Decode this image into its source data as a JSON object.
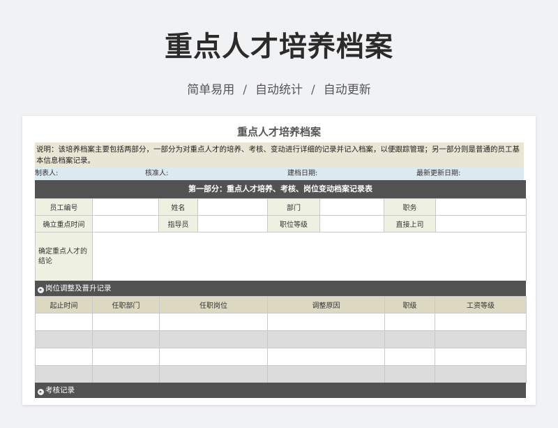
{
  "hero": {
    "title": "重点人才培养档案",
    "subtitle_items": [
      "简单易用",
      "自动统计",
      "自动更新"
    ],
    "separator": "/"
  },
  "document": {
    "title": "重点人才培养档案",
    "description": "说明：该培养档案主要包括两部分，一部分为对重点人才的培养、考核、变动进行详细的记录并记入档案，以便跟踪管理；另一部分则是普通的员工基本信息档案记录。",
    "meta": {
      "preparer": "制表人:",
      "approver": "核准人:",
      "created_date": "建档日期:",
      "updated_date": "最新更新日期:"
    },
    "part1_title": "第一部分：重点人才培养、考核、岗位变动档案记录表",
    "info_rows": [
      [
        "员工编号",
        "",
        "姓名",
        "",
        "部门",
        "",
        "职务",
        ""
      ],
      [
        "确立重点时间",
        "",
        "指导员",
        "",
        "职位等级",
        "",
        "直接上司",
        ""
      ]
    ],
    "conclusion_label": "确定重点人才的结论",
    "section_promotion": {
      "icon": "circle-arrow-icon",
      "label": "岗位调整及晋升记录",
      "headers": [
        "起止时间",
        "任职部门",
        "任职岗位",
        "调整原因",
        "职级",
        "工资等级"
      ],
      "row_count": 4
    },
    "section_assessment": {
      "icon": "circle-arrow-icon",
      "label": "考核记录"
    }
  },
  "colors": {
    "dark_bar": "#525252",
    "label_bg": "#eef1e2",
    "header_bg": "#ddd8c2",
    "desc_bg": "#e9e6d5",
    "meta_bg": "#dbe9f1",
    "row_gray": "#dcdcdc"
  }
}
